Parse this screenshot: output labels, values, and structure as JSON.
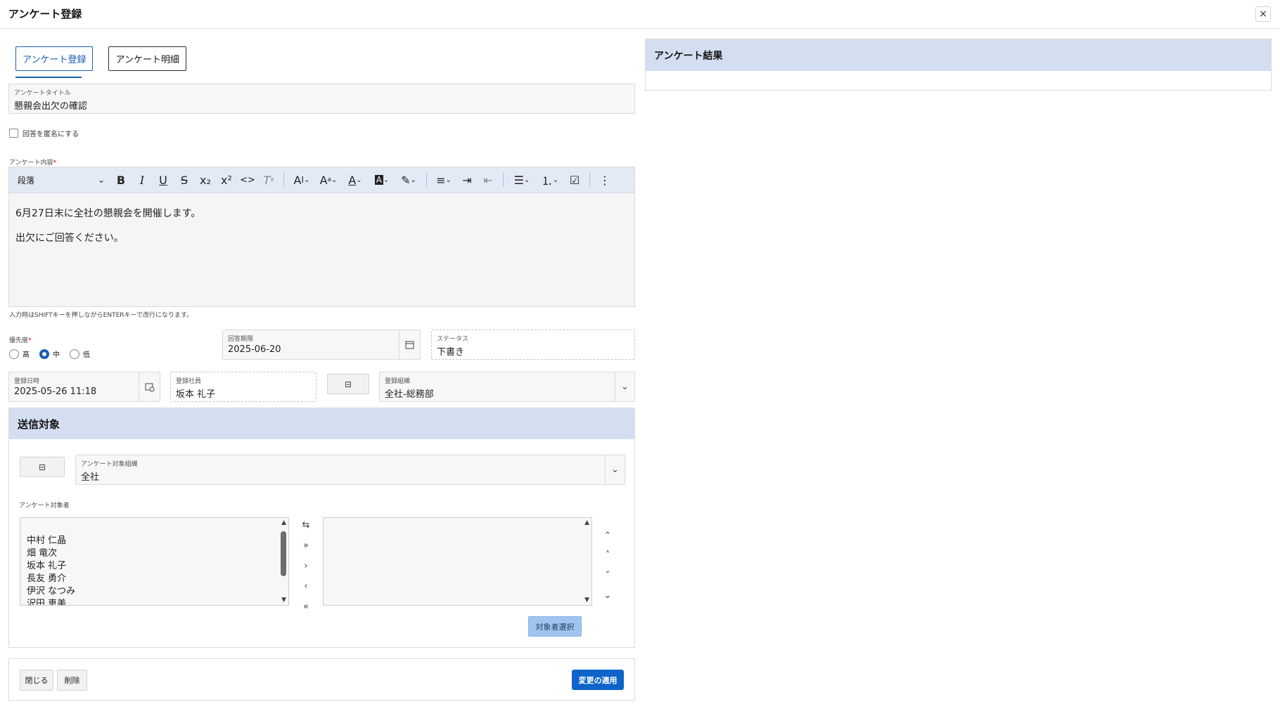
{
  "window": {
    "title": "アンケート登録",
    "close_icon": "×"
  },
  "tabs": [
    {
      "label": "アンケート登録",
      "active": true
    },
    {
      "label": "アンケート明細",
      "active": false
    }
  ],
  "survey_title": {
    "label": "アンケートタイトル",
    "value": "懇親会出欠の確認"
  },
  "anonymous": {
    "label": "回答を匿名にする",
    "checked": false
  },
  "content": {
    "label": "アンケート内容",
    "required_mark": "*",
    "toolbar": {
      "paragraph": "段落",
      "buttons": [
        "bold-icon",
        "italic-icon",
        "underline-icon",
        "strikethrough-icon",
        "subscript-icon",
        "superscript-icon",
        "code-icon",
        "clear-format-icon",
        "font-size-icon",
        "font-family-icon",
        "font-color-icon",
        "background-color-icon",
        "highlight-icon",
        "align-icon",
        "indent-icon",
        "outdent-icon",
        "bullet-list-icon",
        "numbered-list-icon",
        "todo-list-icon",
        "more-icon"
      ]
    },
    "lines": [
      "6月27日末に全社の懇親会を開催します。",
      "出欠にご回答ください。"
    ],
    "hint": "入力時はSHIFTキーを押しながらENTERキーで改行になります。"
  },
  "priority": {
    "label": "優先度",
    "required_mark": "*",
    "options": [
      "高",
      "中",
      "低"
    ],
    "selected": "中"
  },
  "deadline": {
    "label": "回答期限",
    "value": "2025-06-20"
  },
  "status": {
    "label": "ステータス",
    "value": "下書き"
  },
  "registered_at": {
    "label": "登録日時",
    "value": "2025-05-26 11:18"
  },
  "registered_by": {
    "label": "登録社員",
    "value": "坂本 礼子"
  },
  "registered_org": {
    "label": "登録組織",
    "value": "全社-総務部"
  },
  "targets": {
    "header": "送信対象",
    "org": {
      "label": "アンケート対象組織",
      "value": "全社"
    },
    "people_label": "アンケート対象者",
    "available": [
      "中村 仁晶",
      "畑 竜次",
      "坂本 礼子",
      "長友 勇介",
      "伊沢 なつみ",
      "沢田 恵美"
    ],
    "selected": [],
    "select_button": "対象者選択"
  },
  "footer": {
    "close": "閉じる",
    "delete": "削除",
    "apply": "変更の適用"
  },
  "results": {
    "header": "アンケート結果"
  },
  "colors": {
    "accent": "#1a5eb3",
    "header_bg": "#d3def1",
    "apply_bg": "#0e64c8",
    "select_bg": "#9fc5ee"
  }
}
